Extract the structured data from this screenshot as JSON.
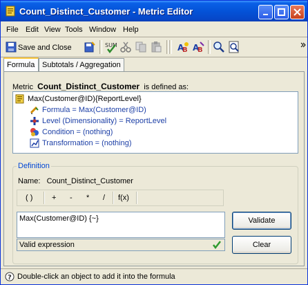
{
  "window": {
    "title": "Count_Distinct_Customer - Metric Editor"
  },
  "menu": {
    "file": "File",
    "edit": "Edit",
    "view": "View",
    "tools": "Tools",
    "window": "Window",
    "help": "Help"
  },
  "toolbar": {
    "save_close": "Save and Close"
  },
  "tabs": [
    {
      "label": "Formula"
    },
    {
      "label": "Subtotals / Aggregation"
    }
  ],
  "metric": {
    "prefix": "Metric",
    "name": "Count_Distinct_Customer",
    "suffix": "is defined as:"
  },
  "tree": {
    "root": "Max(Customer@ID){ReportLevel}",
    "items": [
      {
        "label": "Formula = Max(Customer@ID)"
      },
      {
        "label": "Level (Dimensionality) = ReportLevel"
      },
      {
        "label": "Condition = (nothing)"
      },
      {
        "label": "Transformation = (nothing)"
      }
    ]
  },
  "definition": {
    "title": "Definition",
    "name_label": "Name:",
    "name_value": "Count_Distinct_Customer",
    "operators": [
      "( )",
      "+",
      "-",
      "*",
      "/",
      "f(x)"
    ],
    "expression": "Max(Customer@ID) {~}",
    "status": "Valid expression",
    "validate": "Validate",
    "clear": "Clear"
  },
  "statusbar": {
    "text": "Double-click an object to add it into the formula"
  }
}
